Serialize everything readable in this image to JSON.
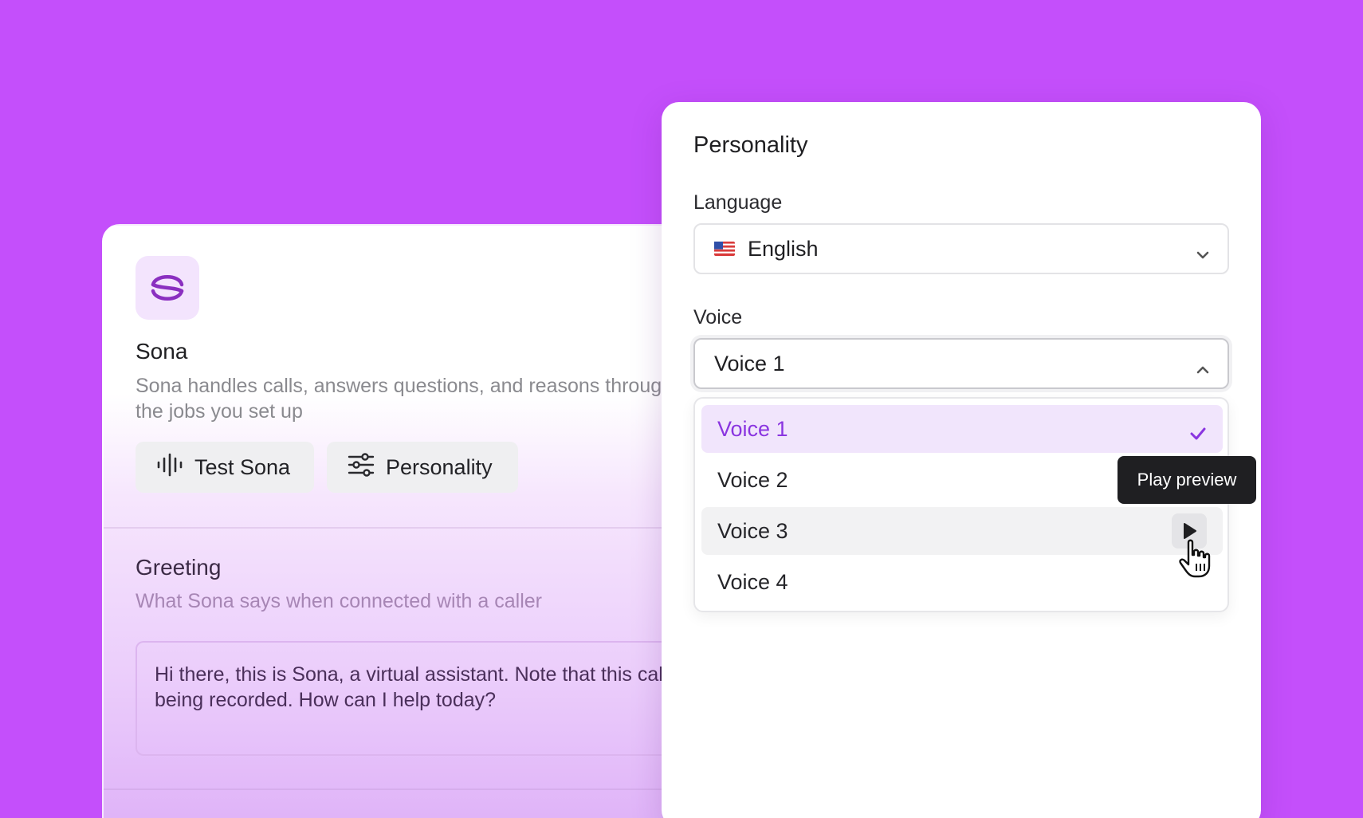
{
  "agent": {
    "name": "Sona",
    "description": "Sona handles calls, answers questions, and reasons through the jobs you set up",
    "icon": "sona-logo-icon"
  },
  "actions": {
    "test_label": "Test Sona",
    "personality_label": "Personality"
  },
  "greeting": {
    "title": "Greeting",
    "subtitle": "What Sona says when connected with a caller",
    "text": "Hi there, this is Sona, a virtual assistant. Note that this call is being recorded. How can I help today?"
  },
  "panel": {
    "title": "Personality",
    "language": {
      "label": "Language",
      "value": "English",
      "flag_icon": "us-flag-icon"
    },
    "voice": {
      "label": "Voice",
      "value": "Voice 1",
      "options": [
        {
          "label": "Voice 1",
          "selected": true
        },
        {
          "label": "Voice 2",
          "selected": false
        },
        {
          "label": "Voice 3",
          "selected": false,
          "hovered": true
        },
        {
          "label": "Voice 4",
          "selected": false
        }
      ]
    },
    "tooltip": "Play preview"
  },
  "colors": {
    "background": "#c44ffb",
    "accent": "#8a35e0",
    "selected_bg": "#f1e5fc",
    "tooltip_bg": "#1f1f22"
  }
}
